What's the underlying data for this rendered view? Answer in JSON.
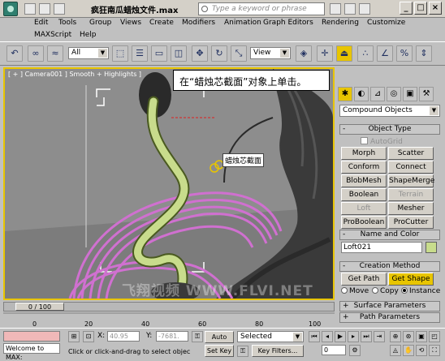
{
  "titlebar": {
    "title": "疯狂南瓜蜡烛文件.max",
    "search_placeholder": "Type a keyword or phrase",
    "min_label": "_",
    "max_label": "□",
    "close_label": "×"
  },
  "menu": {
    "items": [
      "Edit",
      "Tools",
      "Group",
      "Views",
      "Create",
      "Modifiers",
      "Animation",
      "Graph Editors",
      "Rendering",
      "Customize"
    ],
    "row2": [
      "MAXScript",
      "Help"
    ]
  },
  "toolbar": {
    "selection_filter": "All",
    "reference_coord": "View"
  },
  "viewport": {
    "label": "[ + ] Camera001 ] Smooth + Highlights ]",
    "callout": "在“蜡烛芯截面”对象上单击。",
    "tooltip": "蜡烛芯截面",
    "watermark": "飞翔视频 WWW.FLVI.NET"
  },
  "command_panel": {
    "category": "Compound Objects",
    "object_type": {
      "title": "Object Type",
      "autogrid": "AutoGrid",
      "buttons": [
        {
          "label": "Morph",
          "enabled": true
        },
        {
          "label": "Scatter",
          "enabled": true
        },
        {
          "label": "Conform",
          "enabled": true
        },
        {
          "label": "Connect",
          "enabled": true
        },
        {
          "label": "BlobMesh",
          "enabled": true
        },
        {
          "label": "ShapeMerge",
          "enabled": true
        },
        {
          "label": "Boolean",
          "enabled": true
        },
        {
          "label": "Terrain",
          "enabled": false
        },
        {
          "label": "Loft",
          "enabled": false
        },
        {
          "label": "Mesher",
          "enabled": true
        },
        {
          "label": "ProBoolean",
          "enabled": true
        },
        {
          "label": "ProCutter",
          "enabled": true
        }
      ]
    },
    "name_color": {
      "title": "Name and Color",
      "name": "Loft021",
      "color": "#c8dc8c"
    },
    "creation_method": {
      "title": "Creation Method",
      "get_path": "Get Path",
      "get_shape": "Get Shape",
      "move": "Move",
      "copy": "Copy",
      "instance": "Instance"
    },
    "surface_params": "Surface Parameters",
    "path_params": "Path Parameters"
  },
  "timeline": {
    "frame": "0 / 100",
    "ticks": [
      "0",
      "20",
      "40",
      "60",
      "80",
      "100"
    ]
  },
  "status": {
    "welcome": "Welcome to MAX:",
    "x_label": "X:",
    "x_value": "40.95",
    "y_label": "Y:",
    "y_value": "-7681.",
    "prompt": "Click or click-and-drag to select objec",
    "auto_key": "Auto Key",
    "set_key": "Set Key",
    "selected": "Selected",
    "key_filters": "Key Filters...",
    "frame_value": "0"
  },
  "colors": {
    "accent": "#e8c500",
    "candle_wick": "#c8dc8c",
    "loft_tubes": "#d070d0"
  }
}
